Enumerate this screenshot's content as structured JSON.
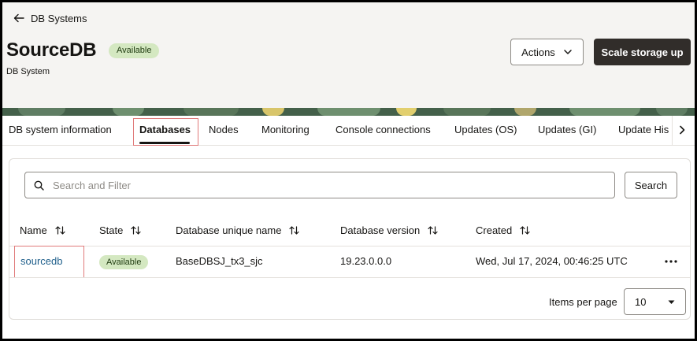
{
  "header": {
    "back_label": "DB Systems",
    "title": "SourceDB",
    "status": "Available",
    "subtitle": "DB System",
    "actions_label": "Actions",
    "scale_label": "Scale storage up"
  },
  "tabs": [
    {
      "label": "DB system information"
    },
    {
      "label": "Databases"
    },
    {
      "label": "Nodes"
    },
    {
      "label": "Monitoring"
    },
    {
      "label": "Console connections"
    },
    {
      "label": "Updates (OS)"
    },
    {
      "label": "Updates (GI)"
    },
    {
      "label": "Update His"
    }
  ],
  "active_tab": "Databases",
  "search": {
    "placeholder": "Search and Filter",
    "button_label": "Search"
  },
  "table": {
    "columns": [
      "Name",
      "State",
      "Database unique name",
      "Database version",
      "Created"
    ],
    "rows": [
      {
        "name": "sourcedb",
        "state": "Available",
        "unique_name": "BaseDBSJ_tx3_sjc",
        "version": "19.23.0.0.0",
        "created": "Wed, Jul 17, 2024, 00:46:25 UTC"
      }
    ]
  },
  "pagination": {
    "items_per_page_label": "Items per page",
    "items_per_page_value": "10"
  },
  "colors": {
    "primary_button": "#312d2a",
    "status_badge": "#d4e8c1",
    "link": "#1f5f8b",
    "highlight_box": "#e07a7a"
  }
}
